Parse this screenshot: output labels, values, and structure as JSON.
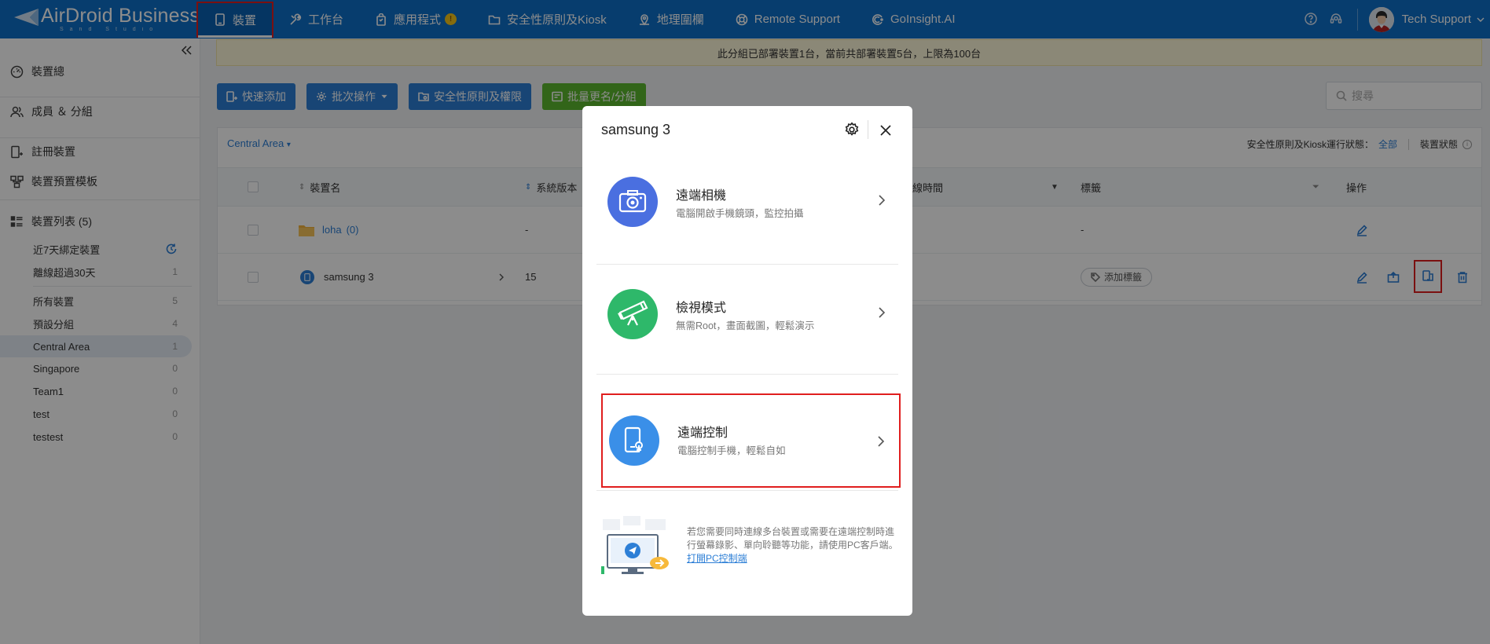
{
  "app": {
    "logo_text": "AirDroid Business",
    "logo_sub": "Sand Studio"
  },
  "nav": {
    "items": [
      {
        "label": "裝置",
        "icon": "device-icon"
      },
      {
        "label": "工作台",
        "icon": "tools-icon"
      },
      {
        "label": "應用程式",
        "icon": "app-bag-icon"
      },
      {
        "label": "安全性原則及Kiosk",
        "icon": "folder-icon"
      },
      {
        "label": "地理圍欄",
        "icon": "map-pin-icon"
      },
      {
        "label": "Remote Support",
        "icon": "remote-support-icon"
      },
      {
        "label": "GoInsight.AI",
        "icon": "ai-icon"
      }
    ],
    "app_badge": "!",
    "user_name": "Tech Support"
  },
  "sidebar": {
    "main": [
      {
        "label": "裝置總"
      },
      {
        "label": "成員 ＆ 分組"
      },
      {
        "label": "註冊裝置"
      },
      {
        "label": "裝置預置模板"
      },
      {
        "label": "裝置列表 (5)"
      }
    ],
    "filters": [
      {
        "label": "近7天綁定裝置"
      },
      {
        "label": "離線超過30天",
        "count": "1"
      }
    ],
    "groups": [
      {
        "label": "所有裝置",
        "count": "5"
      },
      {
        "label": "預設分組",
        "count": "4"
      },
      {
        "label": "Central Area",
        "count": "1"
      },
      {
        "label": "Singapore",
        "count": "0"
      },
      {
        "label": "Team1",
        "count": "0"
      },
      {
        "label": "test",
        "count": "0"
      },
      {
        "label": "testest",
        "count": "0"
      }
    ]
  },
  "notice": "此分組已部署裝置1台，當前共部署裝置5台，上限為100台",
  "toolbar": {
    "quick_add": "快速添加",
    "batch_ops": "批次操作",
    "policy": "安全性原則及權限",
    "rename": "批量更名/分組",
    "search_placeholder": "搜尋"
  },
  "table": {
    "area_selector": "Central Area",
    "status_label": "安全性原則及Kiosk運行狀態：",
    "status_value": "全部",
    "device_status": "裝置狀態",
    "columns": {
      "name": "裝置名",
      "os": "系統版本",
      "online": "線時間",
      "tags": "標籤",
      "actions": "操作"
    },
    "rows": [
      {
        "name": "loha",
        "count": "(0)",
        "os": "-",
        "tags": "-"
      },
      {
        "name": "samsung 3",
        "os": "15",
        "tag_button": "添加標籤"
      }
    ]
  },
  "modal": {
    "title": "samsung 3",
    "options": [
      {
        "title": "遠端相機",
        "desc": "電腦開啟手機鏡頭，監控拍攝",
        "color": "#4a6fe0"
      },
      {
        "title": "檢視模式",
        "desc": "無需Root，畫面截圖，輕鬆演示",
        "color": "#2eb86a"
      },
      {
        "title": "遠端控制",
        "desc": "電腦控制手機，輕鬆自如",
        "color": "#3a8fe8"
      }
    ],
    "footer_text": "若您需要同時連線多台裝置或需要在遠端控制時進行螢幕錄影、單向聆聽等功能，請使用PC客戶端。",
    "footer_link": "打開PC控制端"
  },
  "colors": {
    "nav_bg": "#0d6fc8",
    "primary": "#2d7fd6",
    "green": "#5cb82e",
    "highlight": "#e01e1e"
  }
}
